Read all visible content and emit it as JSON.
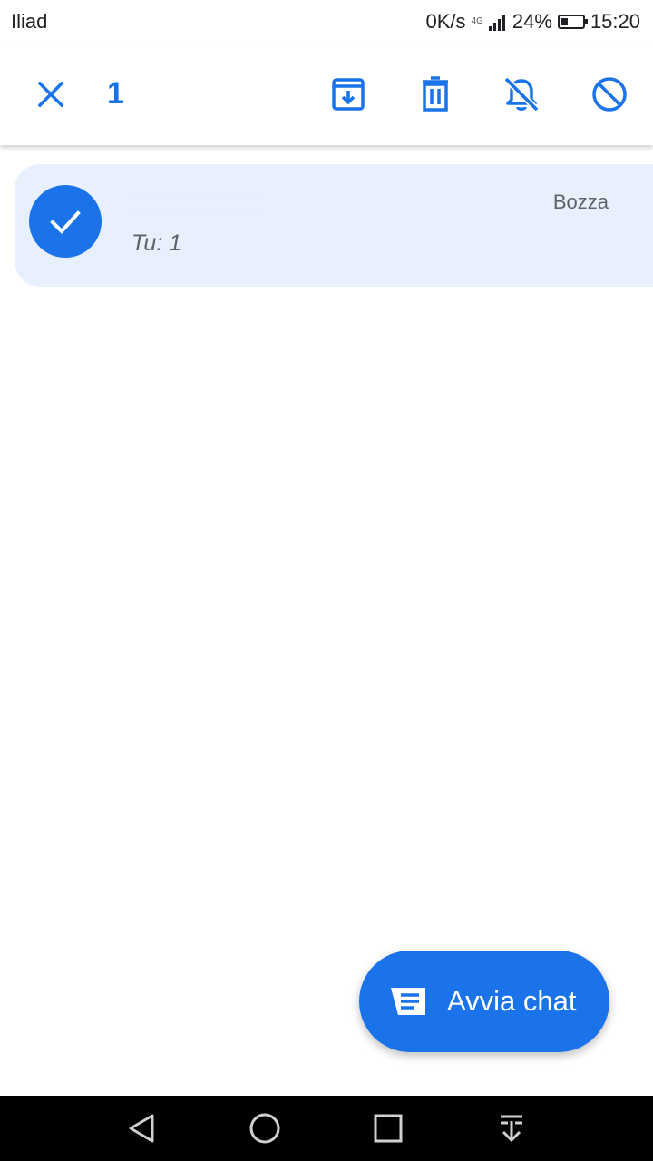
{
  "status_bar": {
    "carrier": "Iliad",
    "speed": "0K/s",
    "network_type": "4G",
    "battery": "24%",
    "time": "15:20"
  },
  "action_bar": {
    "selected_count": "1",
    "icons": [
      "close-icon",
      "archive-icon",
      "delete-icon",
      "mute-icon",
      "block-icon"
    ]
  },
  "conversation": {
    "status": "Bozza",
    "snippet": "Tu: 1",
    "selected": true
  },
  "fab": {
    "label": "Avvia chat",
    "icon": "chat-icon"
  },
  "nav_bar": {
    "icons": [
      "back-icon",
      "home-icon",
      "recents-icon",
      "notifications-pulldown-icon"
    ]
  },
  "colors": {
    "accent": "#1a73e8",
    "selected_row": "#e8f0fe",
    "secondary_text": "#5f6368"
  }
}
